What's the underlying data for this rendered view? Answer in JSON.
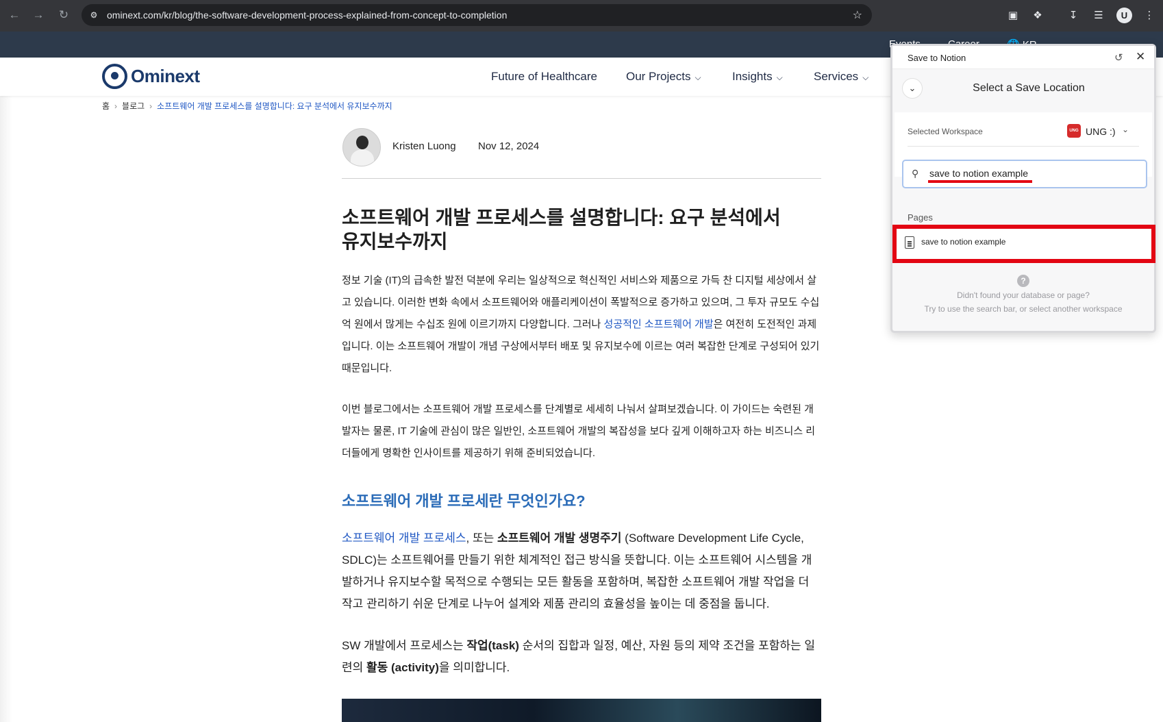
{
  "browser": {
    "url": "ominext.com/kr/blog/the-software-development-process-explained-from-concept-to-completion",
    "avatar_letter": "U"
  },
  "topbar": {
    "events": "Events",
    "career": "Career",
    "lang": "KR"
  },
  "site": {
    "logo": "Ominext",
    "menu": [
      "Future of Healthcare",
      "Our Projects",
      "Insights",
      "Services"
    ]
  },
  "breadcrumb": {
    "home": "홈",
    "blog": "블로그",
    "current": "소프트웨어 개발 프로세스를 설명합니다: 요구 분석에서 유지보수까지"
  },
  "author": {
    "name": "Kristen Luong",
    "date": "Nov 12, 2024"
  },
  "article": {
    "title": "소프트웨어 개발 프로세스를 설명합니다: 요구 분석에서 유지보수까지",
    "p1_a": "정보 기술 (IT)의 급속한 발전 덕분에 우리는 일상적으로 혁신적인 서비스와 제품으로 가득 찬 디지털 세상에서 살고 있습니다. 이러한 변화 속에서 소프트웨어와 애플리케이션이 폭발적으로 증가하고 있으며, 그 투자 규모도 수십억 원에서 많게는 수십조 원에 이르기까지 다양합니다. 그러나 ",
    "p1_link": "성공적인 소프트웨어 개발",
    "p1_b": "은 여전히 도전적인 과제입니다. 이는 소프트웨어 개발이 개념 구상에서부터 배포 및 유지보수에 이르는 여러 복잡한 단계로 구성되어 있기 때문입니다.",
    "p2": "이번 블로그에서는 소프트웨어 개발 프로세스를 단계별로 세세히 나눠서 살펴보겠습니다. 이 가이드는 숙련된 개발자는 물론, IT 기술에 관심이 많은 일반인, 소프트웨어 개발의 복잡성을 보다 깊게 이해하고자 하는 비즈니스 리더들에게 명확한 인사이트를 제공하기 위해 준비되었습니다.",
    "h2": "소프트웨어 개발 프로세란 무엇인가요?",
    "p3_link": "소프트웨어 개발 프로세스",
    "p3_a": ", 또는 ",
    "p3_bold": "소프트웨어 개발 생명주기",
    "p3_b": " (Software Development Life Cycle, SDLC)는 소프트웨어를 만들기 위한 체계적인 접근 방식을 뜻합니다. 이는 소프트웨어 시스템을 개발하거나 유지보수할 목적으로 수행되는 모든 활동을 포함하며, 복잡한 소프트웨어 개발 작업을 더 작고 관리하기 쉬운 단계로 나누어 설계와 제품 관리의 효율성을 높이는 데 중점을 둡니다.",
    "p4_a": "SW 개발에서 프로세스는 ",
    "p4_bold1": "작업(task)",
    "p4_b": " 순서의 집합과 일정, 예산, 자원 등의 제약 조건을 포함하는 일련의 ",
    "p4_bold2": "활동 (activity)",
    "p4_c": "을 의미합니다."
  },
  "notion": {
    "title": "Save to Notion",
    "heading": "Select a Save Location",
    "workspace_label": "Selected Workspace",
    "workspace_badge": "UNG",
    "workspace_name": "UNG :)",
    "search_value": "save to notion example",
    "pages_label": "Pages",
    "page_item": "save to notion example",
    "hint1": "Didn't found your database or page?",
    "hint2": "Try to use the search bar, or select another workspace",
    "accent_color": "#e30613"
  }
}
